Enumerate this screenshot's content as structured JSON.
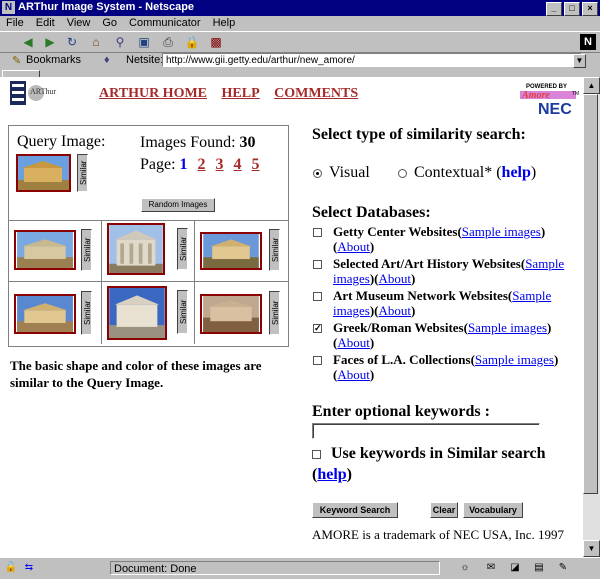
{
  "window": {
    "title": "ARThur Image System - Netscape"
  },
  "menu": [
    "File",
    "Edit",
    "View",
    "Go",
    "Communicator",
    "Help"
  ],
  "location": {
    "bookmarks_label": "Bookmarks",
    "netsite_label": "Netsite:",
    "url": "http://www.gii.getty.edu/arthur/new_amore/"
  },
  "header": {
    "links": [
      "ARTHUR HOME",
      "HELP",
      "COMMENTS"
    ],
    "logo_text": "ARThur",
    "amore": {
      "powered": "POWERED BY",
      "brand": "Amore",
      "nec": "NEC",
      "tm": "TM"
    }
  },
  "query": {
    "label": "Query Image:",
    "found_label": "Images Found:",
    "found_count": "30",
    "page_label": "Page:",
    "pages": [
      "1",
      "2",
      "3",
      "4",
      "5"
    ],
    "random_button": "Random Images",
    "similar_label": "Similar"
  },
  "description": "The basic shape and color of these images are similar to the Query Image.",
  "search_type": {
    "heading": "Select type of similarity search:",
    "visual": "Visual",
    "contextual": "Contextual*",
    "help": "help"
  },
  "databases": {
    "heading": "Select Databases:",
    "items": [
      {
        "name": "Getty Center Websites",
        "sample": "Sample images",
        "about": "About",
        "checked": false
      },
      {
        "name": "Selected Art/Art History Websites",
        "sample": "Sample images",
        "about": "About",
        "checked": false
      },
      {
        "name": "Art Museum Network Websites",
        "sample": "Sample images",
        "about": "About",
        "checked": false
      },
      {
        "name": "Greek/Roman Websites",
        "sample": "Sample images",
        "about": "About",
        "checked": true
      },
      {
        "name": "Faces of L.A. Collections",
        "sample": "Sample images",
        "about": "About",
        "checked": false
      }
    ]
  },
  "keywords": {
    "heading": "Enter optional keywords :",
    "value": "",
    "use_label": "Use keywords in Similar search",
    "help": "help"
  },
  "buttons": {
    "keyword_search": "Keyword Search",
    "clear": "Clear",
    "vocabulary": "Vocabulary"
  },
  "trademark": "AMORE is a trademark of NEC USA, Inc. 1997",
  "status": {
    "text": "Document: Done"
  },
  "colors": {
    "link_blue": "#0000ee",
    "nav_red": "#a52a2a",
    "title_bar": "#000080"
  }
}
